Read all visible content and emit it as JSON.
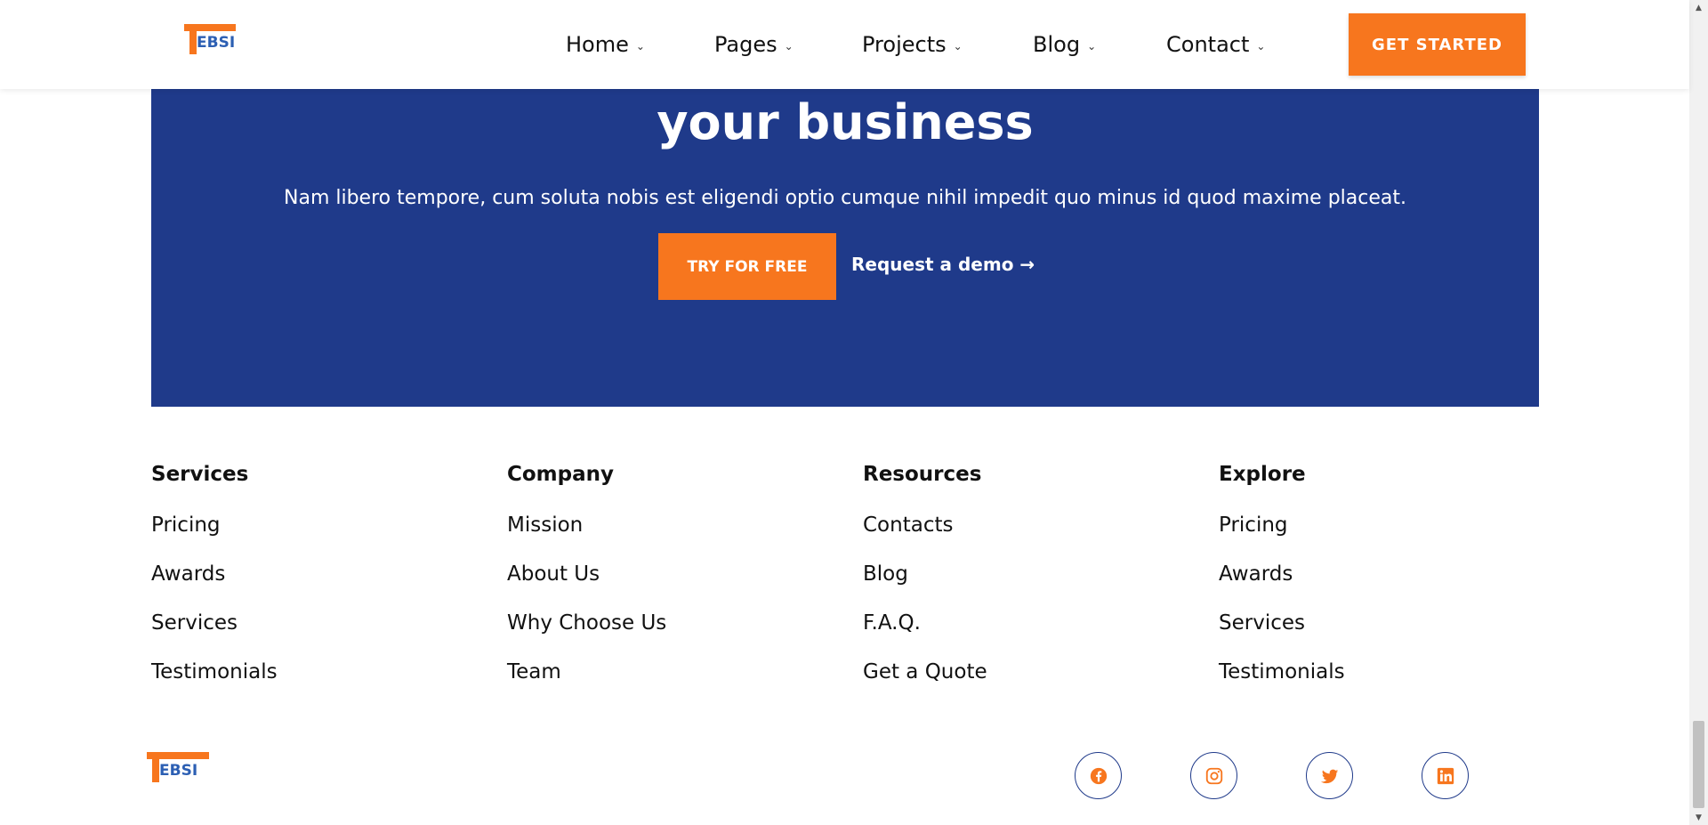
{
  "brand": {
    "logo_text": "EBSI",
    "colors": {
      "accent": "#f7761e",
      "primary": "#1f3a8a",
      "logo_blue": "#2c5fb3"
    }
  },
  "nav": {
    "items": [
      {
        "label": "Home"
      },
      {
        "label": "Pages"
      },
      {
        "label": "Projects"
      },
      {
        "label": "Blog"
      },
      {
        "label": "Contact"
      }
    ],
    "chevron": "⌄",
    "cta_label": "GET STARTED"
  },
  "cta": {
    "title": "your business",
    "text": "Nam libero tempore, cum soluta nobis est eligendi optio cumque nihil impedit quo minus id quod maxime placeat.",
    "primary_label": "TRY FOR FREE",
    "secondary_label": "Request a demo →"
  },
  "footer": {
    "columns": [
      {
        "title": "Services",
        "links": [
          "Pricing",
          "Awards",
          "Services",
          "Testimonials"
        ]
      },
      {
        "title": "Company",
        "links": [
          "Mission",
          "About Us",
          "Why Choose Us",
          "Team"
        ]
      },
      {
        "title": "Resources",
        "links": [
          "Contacts",
          "Blog",
          "F.A.Q.",
          "Get a Quote"
        ]
      },
      {
        "title": "Explore",
        "links": [
          "Pricing",
          "Awards",
          "Services",
          "Testimonials"
        ]
      }
    ],
    "social": [
      {
        "icon": "facebook-icon"
      },
      {
        "icon": "instagram-icon"
      },
      {
        "icon": "twitter-icon"
      },
      {
        "icon": "linkedin-icon"
      }
    ]
  }
}
